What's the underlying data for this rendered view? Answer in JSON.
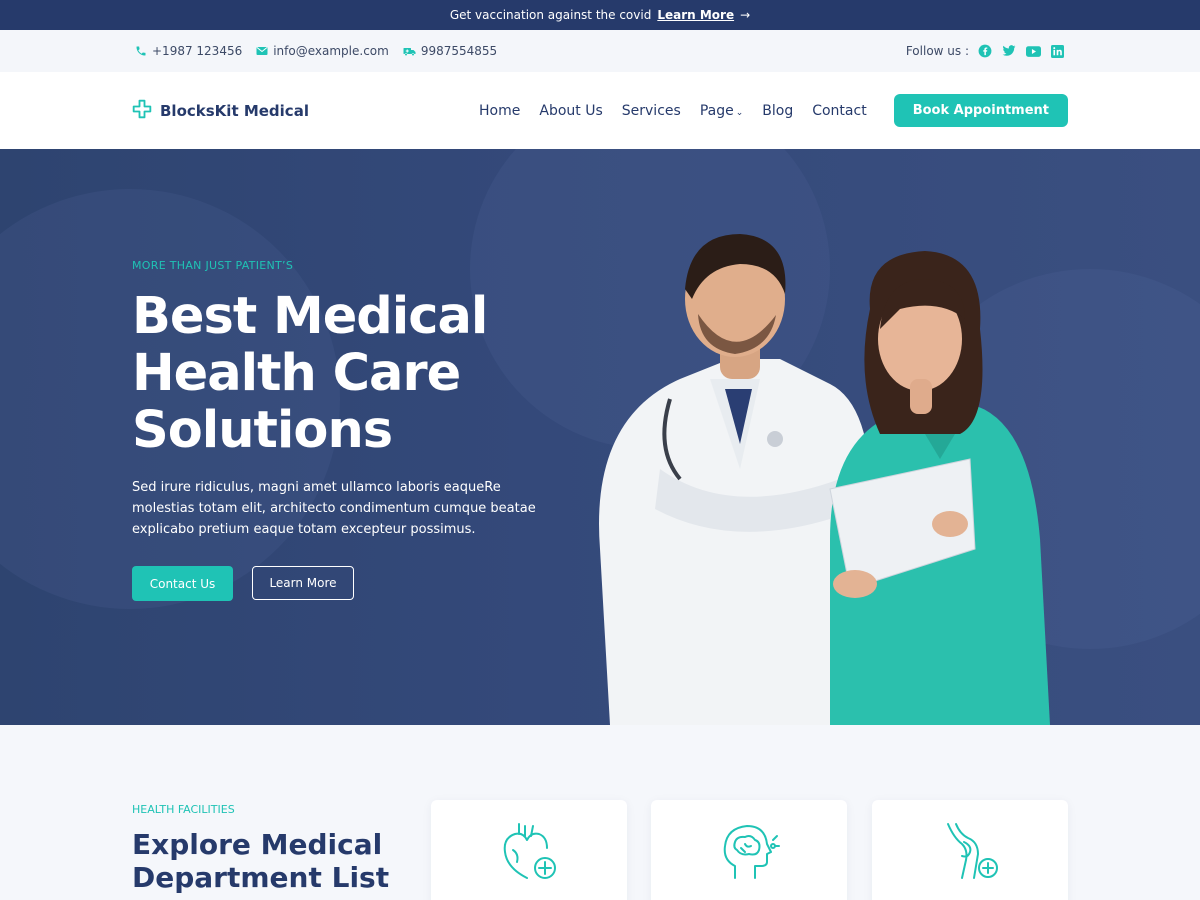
{
  "announcement": {
    "text": "Get vaccination against the covid",
    "link": "Learn More"
  },
  "contact": {
    "phone": "+1987 123456",
    "email": "info@example.com",
    "mobile": "9987554855",
    "follow_label": "Follow us :"
  },
  "brand": {
    "name": "BlocksKit Medical"
  },
  "nav": {
    "items": [
      "Home",
      "About Us",
      "Services",
      "Page",
      "Blog",
      "Contact"
    ],
    "cta": "Book Appointment"
  },
  "hero": {
    "eyebrow": "MORE THAN JUST PATIENT’S",
    "title_lines": [
      "Best Medical",
      "Health Care",
      "Solutions"
    ],
    "description": "Sed irure ridiculus, magni amet ullamco laboris eaqueRe molestias totam elit, architecto condimentum cumque beatae explicabo pretium eaque totam excepteur possimus.",
    "primary_btn": "Contact Us",
    "secondary_btn": "Learn More"
  },
  "facilities": {
    "eyebrow": "HEALTH FACILITIES",
    "title_lines": [
      "Explore Medical",
      "Department List"
    ],
    "cards": [
      "heart-icon",
      "brain-icon",
      "bone-joint-icon"
    ]
  },
  "colors": {
    "primary": "#263a6b",
    "accent": "#1fc3b5",
    "hero_bg": "#34497a"
  }
}
